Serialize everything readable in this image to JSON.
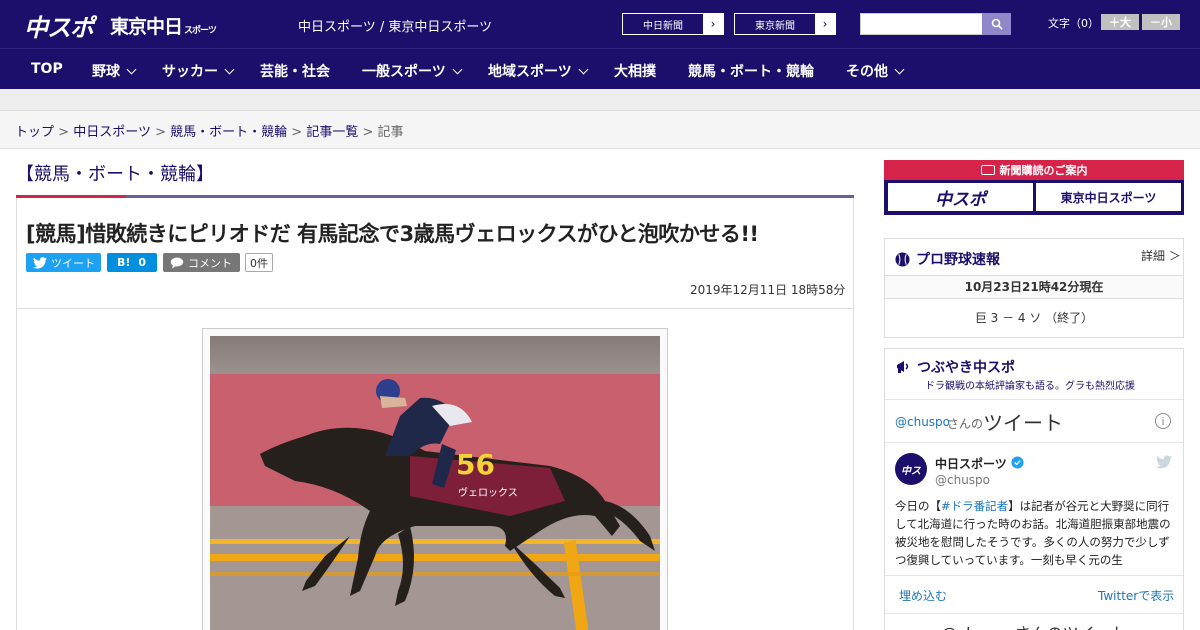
{
  "header": {
    "logo_chuspo": "中スポ",
    "logo_tokyo": "東京中日",
    "logo_tokyo_sub": "スポーツ",
    "site_title": "中日スポーツ / 東京中日スポーツ",
    "ext_links": [
      "中日新聞",
      "東京新聞"
    ],
    "search_placeholder": "",
    "font_label": "文字（0）",
    "font_bigger": "＋大",
    "font_smaller": "－小"
  },
  "nav": {
    "items": [
      {
        "label": "TOP",
        "dropdown": false
      },
      {
        "label": "野球",
        "dropdown": true
      },
      {
        "label": "サッカー",
        "dropdown": true
      },
      {
        "label": "芸能・社会",
        "dropdown": false
      },
      {
        "label": "一般スポーツ",
        "dropdown": true
      },
      {
        "label": "地域スポーツ",
        "dropdown": true
      },
      {
        "label": "大相撲",
        "dropdown": false
      },
      {
        "label": "競馬・ボート・競輪",
        "dropdown": false
      },
      {
        "label": "その他",
        "dropdown": true
      }
    ]
  },
  "breadcrumb": {
    "items": [
      "トップ",
      "中日スポーツ",
      "競馬・ボート・競輪",
      "記事一覧"
    ],
    "current": "記事",
    "separator": ">"
  },
  "category_heading": "【競馬・ボート・競輪】",
  "article": {
    "title": "[競馬]惜敗続きにピリオドだ 有馬記念で3歳馬ヴェロックスがひと泡吹かせる!!",
    "tweet_label": "ツイート",
    "hatena_label": "B!",
    "hatena_count": "0",
    "comment_label": "コメント",
    "comment_count": "0件",
    "date": "2019年12月11日 18時58分",
    "photo_bib": "56",
    "photo_cloth_text": "ヴェロックス"
  },
  "sidebar": {
    "ad_caption": "新聞購読のご案内",
    "ad_buttons": [
      "中スポ",
      "東京中日スポーツ"
    ],
    "baseball": {
      "title": "プロ野球速報",
      "detail_link": "詳細 ＞",
      "timestamp": "10月23日21時42分現在",
      "score": "巨 3 － 4 ソ （終了）"
    },
    "tweets": {
      "title": "つぶやき中スポ",
      "subtitle": "ドラ観戦の本紙評論家も語る。グラも熱烈応援",
      "widget_handle": "@chuspo",
      "widget_suffix": "さんの",
      "widget_title": "ツイート",
      "account_name": "中日スポーツ",
      "account_handle": "@chuspo",
      "tweet_text_pre": "今日の【",
      "tweet_hashtag": "#ドラ番記者",
      "tweet_text_post": "】は記者が谷元と大野奨に同行して北海道に行った時のお話。北海道胆振東部地震の被災地を慰問したそうです。多くの人の努力で少しずつ復興していっています。一刻も早く元の生",
      "embed_label": "埋め込む",
      "view_on_twitter": "Twitterで表示",
      "footer": "@chuspoさんのツイート"
    }
  },
  "colors": {
    "brand_navy": "#1b0f6b",
    "accent_red": "#d6234a",
    "twitter_blue": "#1da1f2",
    "hatena_blue": "#008fde",
    "comment_gray": "#777777"
  }
}
